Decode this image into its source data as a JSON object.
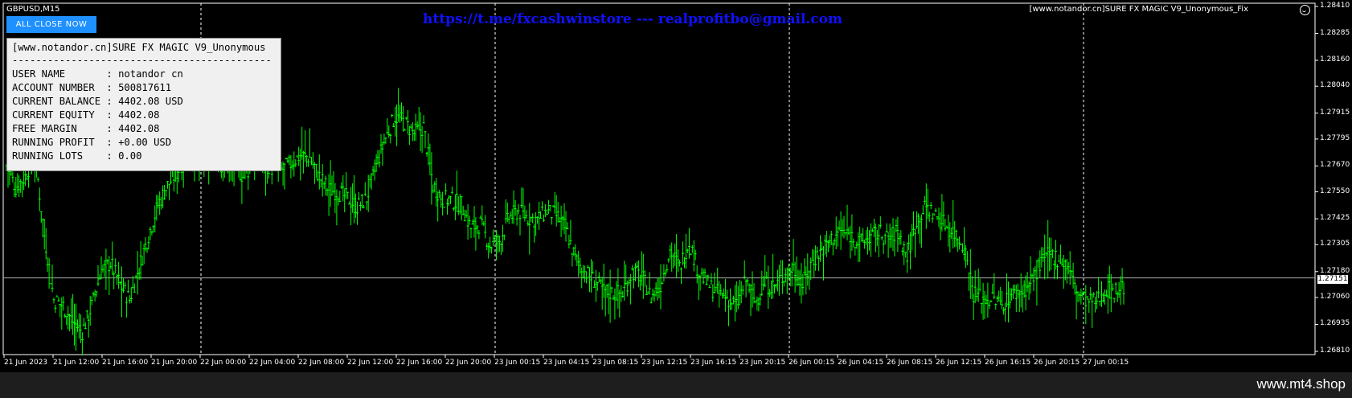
{
  "symbol": "GBPUSD,M15",
  "close_button": "ALL CLOSE NOW",
  "banner": "https://t.me/fxcashwinstore --- realprofitbo@gmail.com",
  "indicator_label": "[www.notandor.cn]SURE FX MAGIC V9_Unonymous_Fix",
  "info_panel": {
    "title": "[www.notandor.cn]SURE FX MAGIC V9_Unonymous",
    "separator": "--------------------------------------------",
    "rows": [
      "USER NAME       : notandor cn",
      "ACCOUNT NUMBER  : 500817611",
      "CURRENT BALANCE : 4402.08 USD",
      "CURRENT EQUITY  : 4402.08",
      "FREE MARGIN     : 4402.08",
      "RUNNING PROFIT  : +0.00 USD",
      "RUNNING LOTS    : 0.00"
    ]
  },
  "price_axis": [
    "1.28410",
    "1.28285",
    "1.28160",
    "1.28040",
    "1.27915",
    "1.27795",
    "1.27670",
    "1.27550",
    "1.27425",
    "1.27305",
    "1.27180",
    "1.27060",
    "1.26935",
    "1.26810"
  ],
  "current_price": "1.27151",
  "time_axis": [
    "21 Jun 2023",
    "21 Jun 12:00",
    "21 Jun 16:00",
    "21 Jun 20:00",
    "22 Jun 00:00",
    "22 Jun 04:00",
    "22 Jun 08:00",
    "22 Jun 12:00",
    "22 Jun 16:00",
    "22 Jun 20:00",
    "23 Jun 00:15",
    "23 Jun 04:15",
    "23 Jun 08:15",
    "23 Jun 12:15",
    "23 Jun 16:15",
    "23 Jun 20:15",
    "26 Jun 00:15",
    "26 Jun 04:15",
    "26 Jun 08:15",
    "26 Jun 12:15",
    "26 Jun 16:15",
    "26 Jun 20:15",
    "27 Jun 00:15"
  ],
  "footer": "www.mt4.shop",
  "colors": {
    "candle": "#00ff00",
    "background": "#000000",
    "button": "#1e90ff",
    "banner": "#1010ff"
  },
  "chart_data": {
    "type": "line",
    "title": "GBPUSD,M15",
    "ylim": [
      1.2681,
      1.2841
    ],
    "series": [
      {
        "values": [
          1.2767,
          1.2757,
          1.2762,
          1.2773,
          1.2735,
          1.2705,
          1.2702,
          1.2695,
          1.269,
          1.2702,
          1.2718,
          1.2722,
          1.2712,
          1.2705,
          1.272,
          1.2735,
          1.2749,
          1.2758,
          1.2764,
          1.2772,
          1.277,
          1.2768,
          1.2771,
          1.2766,
          1.2768,
          1.2762,
          1.2768,
          1.277,
          1.2766,
          1.2765,
          1.2768,
          1.2772,
          1.2771,
          1.2762,
          1.2756,
          1.2755,
          1.2752,
          1.2748,
          1.2752,
          1.2767,
          1.278,
          1.279,
          1.2787,
          1.2782,
          1.2785,
          1.2758,
          1.2752,
          1.2751,
          1.2749,
          1.2738,
          1.274,
          1.273,
          1.2732,
          1.2743,
          1.2746,
          1.2743,
          1.2742,
          1.2746,
          1.2744,
          1.2738,
          1.2724,
          1.2718,
          1.2714,
          1.2709,
          1.2708,
          1.2708,
          1.2718,
          1.2716,
          1.2706,
          1.2712,
          1.2728,
          1.272,
          1.2732,
          1.2718,
          1.2712,
          1.2708,
          1.2706,
          1.2702,
          1.2714,
          1.2704,
          1.2712,
          1.2711,
          1.2716,
          1.272,
          1.2712,
          1.2723,
          1.2728,
          1.2733,
          1.2737,
          1.2735,
          1.2731,
          1.2734,
          1.2736,
          1.2733,
          1.2737,
          1.2725,
          1.2742,
          1.2748,
          1.2744,
          1.274,
          1.2736,
          1.273,
          1.2708,
          1.2706,
          1.2705,
          1.2703,
          1.2707,
          1.2709,
          1.2712,
          1.2721,
          1.2726,
          1.2724,
          1.272,
          1.2708,
          1.2704,
          1.2704,
          1.271,
          1.2709,
          1.2711
        ]
      }
    ],
    "xlabel": "",
    "ylabel": "",
    "grid": false
  }
}
